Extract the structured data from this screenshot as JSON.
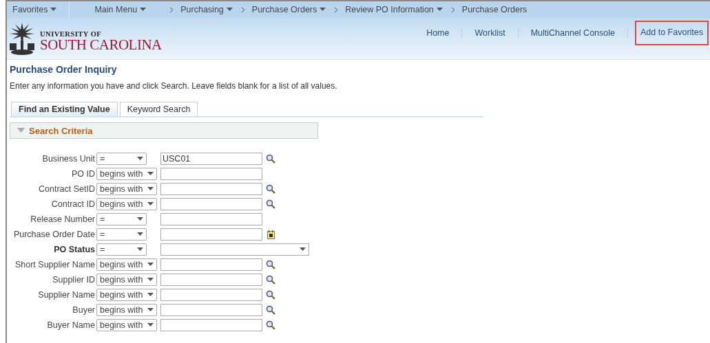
{
  "breadcrumbs": [
    {
      "label": "Favorites",
      "dropdown": true,
      "separator": false
    },
    {
      "label": "Main Menu",
      "dropdown": true,
      "separator": false
    },
    {
      "label": "Purchasing",
      "dropdown": true,
      "separator": true
    },
    {
      "label": "Purchase Orders",
      "dropdown": true,
      "separator": true
    },
    {
      "label": "Review PO Information",
      "dropdown": true,
      "separator": true
    },
    {
      "label": "Purchase Orders",
      "dropdown": false,
      "separator": true
    }
  ],
  "logo": {
    "line1": "UNIVERSITY OF",
    "line2": "SOUTH CAROLINA"
  },
  "header_links": [
    {
      "label": "Home",
      "highlighted": false
    },
    {
      "label": "Worklist",
      "highlighted": false
    },
    {
      "label": "MultiChannel Console",
      "highlighted": false
    },
    {
      "label": "Add to Favorites",
      "highlighted": true
    }
  ],
  "page_title": "Purchase Order Inquiry",
  "instructions": "Enter any information you have and click Search. Leave fields blank for a list of all values.",
  "tabs": [
    {
      "label": "Find an Existing Value",
      "selected": true
    },
    {
      "label": "Keyword Search",
      "selected": false
    }
  ],
  "section": {
    "title": "Search Criteria",
    "expanded": true
  },
  "fields": [
    {
      "label": "Business Unit",
      "bold": false,
      "operator": "=",
      "value": "USC01",
      "kind": "lookup"
    },
    {
      "label": "PO ID",
      "bold": false,
      "operator": "begins with",
      "kind": "plain"
    },
    {
      "label": "Contract SetID",
      "bold": false,
      "operator": "begins with",
      "kind": "lookup"
    },
    {
      "label": "Contract ID",
      "bold": false,
      "operator": "begins with",
      "kind": "lookup"
    },
    {
      "label": "Release Number",
      "bold": false,
      "operator": "=",
      "kind": "plain"
    },
    {
      "label": "Purchase Order Date",
      "bold": false,
      "operator": "=",
      "kind": "date"
    },
    {
      "label": "PO Status",
      "bold": true,
      "operator": "=",
      "kind": "select"
    },
    {
      "label": "Short Supplier Name",
      "bold": false,
      "operator": "begins with",
      "kind": "lookup"
    },
    {
      "label": "Supplier ID",
      "bold": false,
      "operator": "begins with",
      "kind": "lookup"
    },
    {
      "label": "Supplier Name",
      "bold": false,
      "operator": "begins with",
      "kind": "lookup"
    },
    {
      "label": "Buyer",
      "bold": false,
      "operator": "begins with",
      "kind": "lookup"
    },
    {
      "label": "Buyer Name",
      "bold": false,
      "operator": "begins with",
      "kind": "lookup"
    }
  ]
}
